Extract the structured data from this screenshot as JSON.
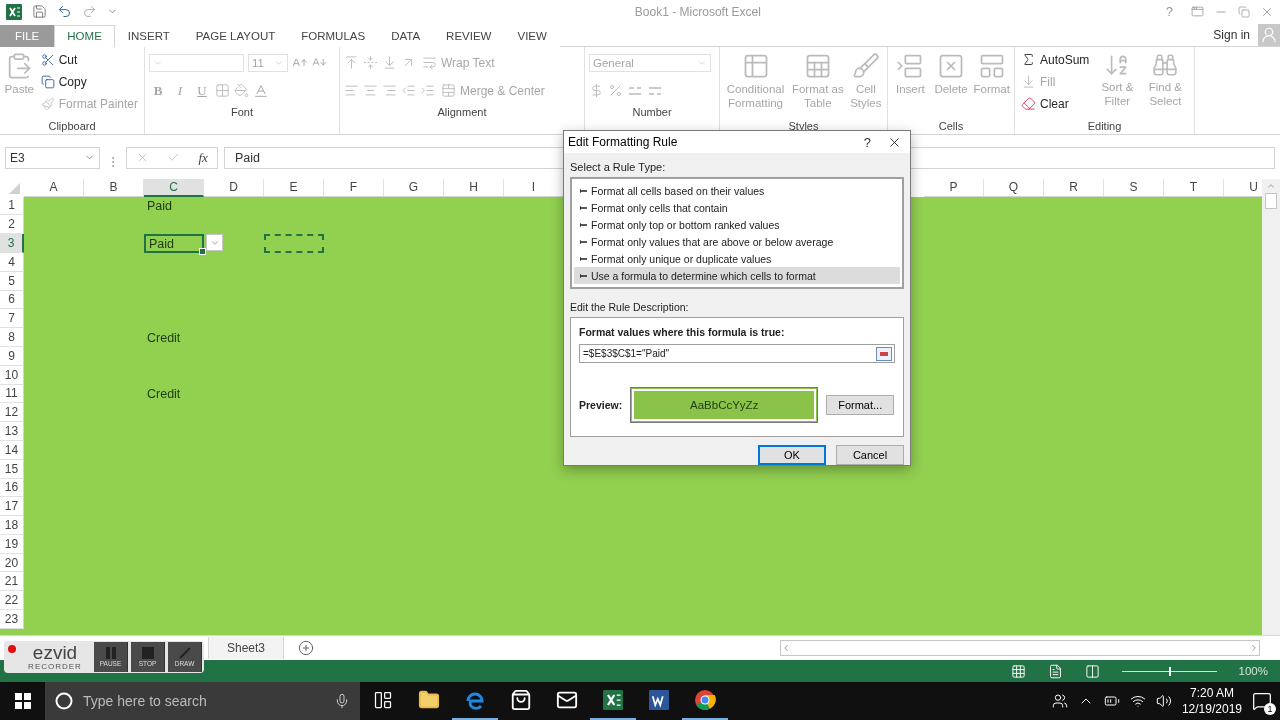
{
  "title_bar": {
    "title": "Book1 - Microsoft Excel",
    "help": "?"
  },
  "ribbon_tabs": [
    {
      "label": "FILE",
      "kind": "file",
      "selected": false
    },
    {
      "label": "HOME",
      "kind": "tab",
      "selected": true
    },
    {
      "label": "INSERT",
      "kind": "tab",
      "selected": false
    },
    {
      "label": "PAGE LAYOUT",
      "kind": "tab",
      "selected": false
    },
    {
      "label": "FORMULAS",
      "kind": "tab",
      "selected": false
    },
    {
      "label": "DATA",
      "kind": "tab",
      "selected": false
    },
    {
      "label": "REVIEW",
      "kind": "tab",
      "selected": false
    },
    {
      "label": "VIEW",
      "kind": "tab",
      "selected": false
    }
  ],
  "account": {
    "label": "Sign in"
  },
  "ribbon": {
    "clipboard": {
      "label": "Clipboard",
      "paste": {
        "label": "Paste",
        "disabled": true
      },
      "cut": {
        "label": "Cut",
        "disabled": false
      },
      "copy": {
        "label": "Copy",
        "disabled": false
      },
      "format_painter": {
        "label": "Format Painter",
        "disabled": true
      }
    },
    "font": {
      "label": "Font",
      "size": "11",
      "bold": "B",
      "italic": "I",
      "underline": "U"
    },
    "alignment": {
      "label": "Alignment",
      "wrap_text": {
        "label": "Wrap Text",
        "disabled": true
      },
      "merge_center": {
        "label": "Merge & Center",
        "disabled": true
      }
    },
    "number": {
      "label": "Number",
      "format": "General"
    },
    "styles": {
      "label": "Styles",
      "buttons": [
        {
          "label": "Conditional Formatting",
          "disabled": true
        },
        {
          "label": "Format as Table",
          "disabled": true
        },
        {
          "label": "Cell Styles",
          "disabled": true
        }
      ]
    },
    "cells": {
      "label": "Cells",
      "buttons": [
        {
          "label": "Insert",
          "disabled": true
        },
        {
          "label": "Delete",
          "disabled": true
        },
        {
          "label": "Format",
          "disabled": true
        }
      ]
    },
    "editing": {
      "label": "Editing",
      "autosum": {
        "label": "AutoSum",
        "disabled": false
      },
      "fill": {
        "label": "Fill",
        "disabled": true
      },
      "clear": {
        "label": "Clear",
        "disabled": false
      },
      "buttons": [
        {
          "label": "Sort & Filter",
          "disabled": true
        },
        {
          "label": "Find & Select",
          "disabled": true
        }
      ]
    }
  },
  "formula_bar": {
    "name_box": "E3",
    "function_label": "fx",
    "formula": "Paid"
  },
  "column_headers": [
    {
      "label": "A",
      "selected": false
    },
    {
      "label": "B",
      "selected": false
    },
    {
      "label": "C",
      "selected": true
    },
    {
      "label": "D",
      "selected": false
    },
    {
      "label": "E",
      "selected": false
    },
    {
      "label": "F",
      "selected": false
    },
    {
      "label": "G",
      "selected": false
    },
    {
      "label": "H",
      "selected": false
    },
    {
      "label": "I",
      "selected": false
    }
  ],
  "column_headers_right": [
    {
      "label": "P",
      "selected": false
    },
    {
      "label": "Q",
      "selected": false
    },
    {
      "label": "R",
      "selected": false
    },
    {
      "label": "S",
      "selected": false
    },
    {
      "label": "T",
      "selected": false
    },
    {
      "label": "U",
      "selected": false
    }
  ],
  "rows": [
    {
      "label": "1",
      "selected": false,
      "cells": {
        "C": {
          "value": "Paid",
          "selected": false,
          "copied": false
        }
      }
    },
    {
      "label": "2",
      "selected": false
    },
    {
      "label": "3",
      "selected": true,
      "cells": {
        "C": {
          "value": "Paid",
          "selected": true,
          "copied": false
        },
        "E": {
          "selected": false,
          "copied": true
        }
      }
    },
    {
      "label": "4",
      "selected": false
    },
    {
      "label": "5",
      "selected": false
    },
    {
      "label": "6",
      "selected": false
    },
    {
      "label": "7",
      "selected": false
    },
    {
      "label": "8",
      "selected": false,
      "cells": {
        "C": {
          "value": "Credit",
          "selected": false,
          "copied": false
        }
      }
    },
    {
      "label": "9",
      "selected": false
    },
    {
      "label": "10",
      "selected": false
    },
    {
      "label": "11",
      "selected": false,
      "cells": {
        "C": {
          "value": "Credit",
          "selected": false,
          "copied": false
        }
      }
    },
    {
      "label": "12",
      "selected": false
    },
    {
      "label": "13",
      "selected": false
    },
    {
      "label": "14",
      "selected": false
    },
    {
      "label": "15",
      "selected": false
    },
    {
      "label": "16",
      "selected": false
    },
    {
      "label": "17",
      "selected": false
    },
    {
      "label": "18",
      "selected": false
    },
    {
      "label": "19",
      "selected": false
    },
    {
      "label": "20",
      "selected": false
    },
    {
      "label": "21",
      "selected": false
    },
    {
      "label": "22",
      "selected": false
    },
    {
      "label": "23",
      "selected": false
    }
  ],
  "validation_dropdown": {
    "shown": true
  },
  "sheet_tabs": [
    {
      "label": "Sheet3",
      "selected": false
    }
  ],
  "status_bar": {
    "zoom": {
      "level": 0.5,
      "reading": "100%"
    }
  },
  "dialog": {
    "title": "Edit Formatting Rule",
    "help": "?",
    "rule_type_label": "Select a Rule Type:",
    "rule_types": [
      {
        "label": "Format all cells based on their values",
        "selected": false
      },
      {
        "label": "Format only cells that contain",
        "selected": false
      },
      {
        "label": "Format only top or bottom ranked values",
        "selected": false
      },
      {
        "label": "Format only values that are above or below average",
        "selected": false
      },
      {
        "label": "Format only unique or duplicate values",
        "selected": false
      },
      {
        "label": "Use a formula to determine which cells to format",
        "selected": true
      }
    ],
    "description_label": "Edit the Rule Description:",
    "formula_label": "Format values where this formula is true:",
    "formula": "=$E$3$C$1=\"Paid\"",
    "preview_label": "Preview:",
    "preview_sample": "AaBbCcYyZz",
    "buttons": [
      {
        "label": "Format...",
        "kind": "format",
        "default": false
      },
      {
        "label": "OK",
        "kind": "ok",
        "default": true
      },
      {
        "label": "Cancel",
        "kind": "cancel",
        "default": false
      }
    ]
  },
  "recorder": {
    "logo": "ezvid",
    "subtitle": "RECORDER",
    "recording": true,
    "buttons": [
      {
        "label": "PAUSE",
        "kind": "pause"
      },
      {
        "label": "STOP",
        "kind": "stop"
      },
      {
        "label": "DRAW",
        "kind": "draw"
      }
    ]
  },
  "taskbar": {
    "search_placeholder": "Type here to search",
    "apps": [
      {
        "kind": "taskview",
        "running": false
      },
      {
        "kind": "folder",
        "running": false
      },
      {
        "kind": "edge",
        "running": true
      },
      {
        "kind": "store",
        "running": false
      },
      {
        "kind": "mail",
        "running": false
      },
      {
        "kind": "excel",
        "running": true
      },
      {
        "kind": "word",
        "running": false
      },
      {
        "kind": "chrome",
        "running": true
      }
    ],
    "time": "7:20 AM",
    "date": "12/19/2019",
    "notifications": "1"
  }
}
